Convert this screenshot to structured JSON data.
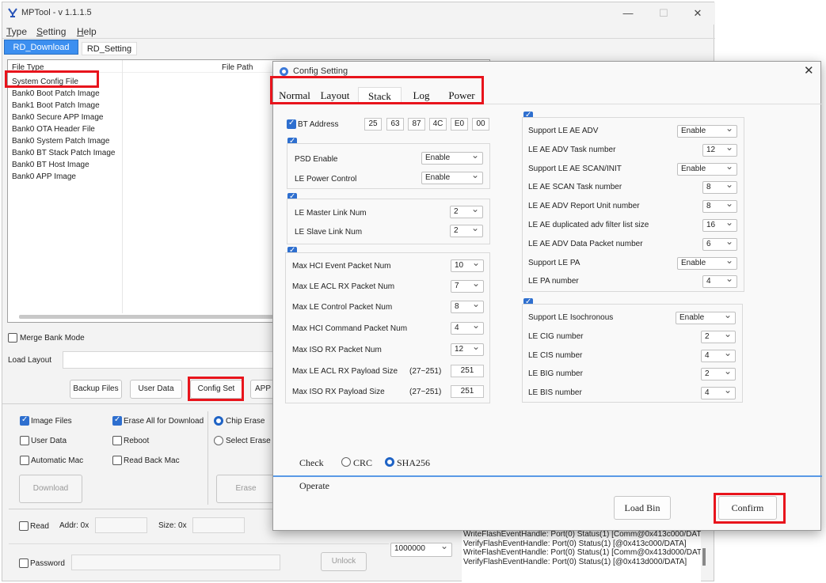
{
  "window": {
    "title": "MPTool - v 1.1.1.5",
    "min": "—",
    "max": "☐",
    "close": "✕"
  },
  "menu": [
    "Type",
    "Setting",
    "Help"
  ],
  "tabs": [
    "RD_Download",
    "RD_Setting"
  ],
  "filelist": {
    "col_type": "File Type",
    "col_path": "File Path",
    "rows": [
      "System Config File",
      "Bank0 Boot Patch Image",
      "Bank1 Boot Patch Image",
      "Bank0 Secure APP Image",
      "Bank0 OTA Header File",
      "Bank0 System Patch Image",
      "Bank0 BT Stack Patch Image",
      "Bank0 BT Host Image",
      "Bank0 APP Image"
    ]
  },
  "main": {
    "merge_bank": "Merge Bank Mode",
    "load_layout": "Load Layout",
    "buttons": {
      "backup": "Backup Files",
      "user_data": "User Data",
      "config_set": "Config Set",
      "app": "APP"
    },
    "opts": {
      "image_files": "Image Files",
      "user_data": "User Data",
      "auto_mac": "Automatic Mac",
      "erase_all": "Erase All for Download",
      "reboot": "Reboot",
      "read_back_mac": "Read Back Mac",
      "chip_erase": "Chip Erase",
      "select_erase": "Select Erase"
    },
    "download": "Download",
    "erase": "Erase",
    "read": "Read",
    "addr": "Addr:  0x",
    "size": "Size:  0x",
    "password": "Password",
    "unlock": "Unlock",
    "baud": "1000000"
  },
  "log": [
    "WriteFlashEventHandle: Port(0) Status(1) [Comm@0x413c000/DATA]",
    "VerifyFlashEventHandle: Port(0) Status(1) [@0x413c000/DATA]",
    "WriteFlashEventHandle: Port(0) Status(1) [Comm@0x413d000/DATA]",
    "VerifyFlashEventHandle: Port(0) Status(1) [@0x413d000/DATA]"
  ],
  "dialog": {
    "title": "Config Setting",
    "close": "✕",
    "tabs": [
      "Normal",
      "Layout",
      "Stack",
      "Log",
      "Power"
    ],
    "bt_address": {
      "label": "BT Address",
      "bytes": [
        "25",
        "63",
        "87",
        "4C",
        "E0",
        "00"
      ]
    },
    "psd": {
      "label": "PSD Enable",
      "value": "Enable"
    },
    "le_power": {
      "label": "LE Power Control",
      "value": "Enable"
    },
    "le_master": {
      "label": "LE Master Link Num",
      "value": "2"
    },
    "le_slave": {
      "label": "LE Slave Link Num",
      "value": "2"
    },
    "hci_group": [
      {
        "label": "Max HCI Event Packet Num",
        "value": "10"
      },
      {
        "label": "Max LE ACL RX Packet Num",
        "value": "7"
      },
      {
        "label": "Max LE Control Packet Num",
        "value": "8"
      },
      {
        "label": "Max HCI Command Packet Num",
        "value": "4"
      },
      {
        "label": "Max ISO RX Packet Num",
        "value": "12"
      }
    ],
    "payload": [
      {
        "label": "Max LE ACL RX Payload Size",
        "range": "(27~251)",
        "value": "251"
      },
      {
        "label": "Max ISO RX Payload Size",
        "range": "(27~251)",
        "value": "251"
      }
    ],
    "ae_group": [
      {
        "label": "Support LE AE ADV",
        "value": "Enable",
        "wide": true
      },
      {
        "label": "LE AE ADV Task number",
        "value": "12",
        "wide": false
      },
      {
        "label": "Support LE AE SCAN/INIT",
        "value": "Enable",
        "wide": true
      },
      {
        "label": "LE AE SCAN Task number",
        "value": "8",
        "wide": false
      },
      {
        "label": "LE AE ADV Report Unit number",
        "value": "8",
        "wide": false
      },
      {
        "label": "LE AE duplicated adv filter list size",
        "value": "16",
        "wide": false
      },
      {
        "label": "LE AE ADV Data Packet number",
        "value": "6",
        "wide": false
      },
      {
        "label": "Support LE PA",
        "value": "Enable",
        "wide": true
      },
      {
        "label": "LE PA number",
        "value": "4",
        "wide": false
      }
    ],
    "iso_group": [
      {
        "label": "Support LE Isochronous",
        "value": "Enable",
        "wide": true
      },
      {
        "label": "LE CIG number",
        "value": "2",
        "wide": false
      },
      {
        "label": "LE CIS number",
        "value": "4",
        "wide": false
      },
      {
        "label": "LE BIG number",
        "value": "2",
        "wide": false
      },
      {
        "label": "LE BIS number",
        "value": "4",
        "wide": false
      }
    ],
    "check": {
      "label": "Check",
      "crc": "CRC",
      "sha": "SHA256"
    },
    "operate": "Operate",
    "load_bin": "Load Bin",
    "confirm": "Confirm"
  }
}
